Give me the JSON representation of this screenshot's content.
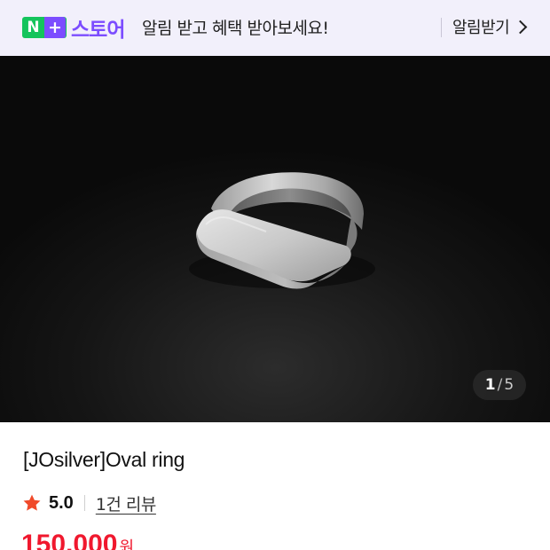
{
  "banner": {
    "logo_n": "N",
    "logo_plus": "+",
    "logo_text": "스토어",
    "message": "알림 받고 혜택 받아보세요!",
    "cta_label": "알림받기",
    "cta_icon": "chevron-right-icon"
  },
  "gallery": {
    "current": "1",
    "separator": "/",
    "total": "5",
    "image_icon": "silver-ring-photo"
  },
  "product": {
    "title": "[JOsilver]Oval ring",
    "rating": "5.0",
    "review_link": "1건 리뷰",
    "price": "150,000",
    "currency": "원"
  },
  "colors": {
    "brand_green": "#14c45c",
    "brand_purple": "#7c4dff",
    "banner_bg": "#f2f0fb",
    "star": "#f04a2a",
    "price_red": "#f0182e"
  }
}
